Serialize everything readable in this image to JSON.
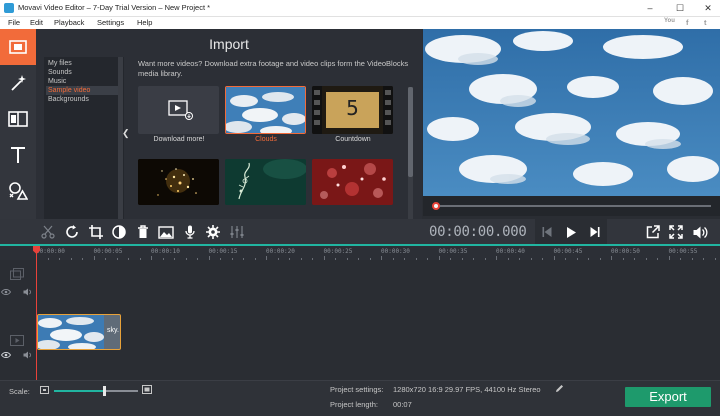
{
  "window": {
    "title": "Movavi Video Editor – 7-Day Trial Version – New Project *",
    "minimize": "–",
    "maximize": "☐",
    "close": "✕"
  },
  "menu": [
    "File",
    "Edit",
    "Playback",
    "Settings",
    "Help"
  ],
  "social": [
    "You",
    "f",
    "t"
  ],
  "import": {
    "title": "Import",
    "categories": [
      "My files",
      "Sounds",
      "Music",
      "Sample video",
      "Backgrounds"
    ],
    "selected_category": "Sample video",
    "description": "Want more videos? Download extra footage and video clips form the VideoBlocks media library.",
    "tiles": [
      {
        "label": "Download more!"
      },
      {
        "label": "Clouds",
        "selected": true
      },
      {
        "label": "Countdown",
        "number": "5"
      },
      {
        "label": ""
      },
      {
        "label": ""
      },
      {
        "label": ""
      }
    ]
  },
  "timecode": "00:00:00.000",
  "ruler": [
    "00:00:00",
    "00:00:05",
    "00:00:10",
    "00:00:15",
    "00:00:20",
    "00:00:25",
    "00:00:30",
    "00:00:35",
    "00:00:40",
    "00:00:45",
    "00:00:50",
    "00:00:55"
  ],
  "clip": {
    "label": "sky."
  },
  "bottom": {
    "scale_label": "Scale:",
    "scale_value": 0.6,
    "project_settings_label": "Project settings:",
    "project_settings_value": "1280x720 16:9 29.97 FPS, 44100 Hz Stereo",
    "project_length_label": "Project length:",
    "project_length_value": "00:07",
    "export_label": "Export"
  },
  "colors": {
    "accent": "#f26b3a",
    "teal": "#21b5a1",
    "export": "#1e9a6c",
    "playhead": "#e8423a"
  }
}
